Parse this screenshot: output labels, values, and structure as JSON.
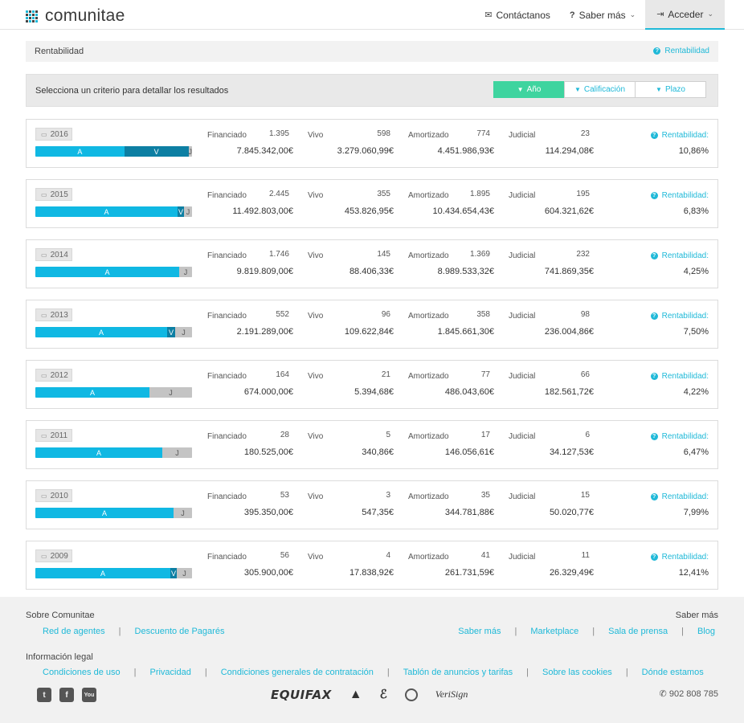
{
  "header": {
    "logo": "comunitae",
    "nav": [
      {
        "label": "Contáctanos",
        "icon": "envelope-icon"
      },
      {
        "label": "Saber más",
        "icon": "question-icon"
      },
      {
        "label": "Acceder",
        "icon": "sign-in-icon"
      }
    ]
  },
  "breadcrumb": {
    "title": "Rentabilidad",
    "help_link": "Rentabilidad"
  },
  "criteria": {
    "label": "Selecciona un criterio para detallar los resultados",
    "options": [
      "Año",
      "Calificación",
      "Plazo"
    ],
    "selected": "Año"
  },
  "labels": {
    "financiado": "Financiado",
    "vivo": "Vivo",
    "amortizado": "Amortizado",
    "judicial": "Judicial",
    "rentabilidad": "Rentabilidad:"
  },
  "years": [
    {
      "year": "2016",
      "fin_count": "1.395",
      "fin_amount": "7.845.342,00€",
      "vivo_count": "598",
      "vivo_amount": "3.279.060,99€",
      "amort_count": "774",
      "amort_amount": "4.451.986,93€",
      "jud_count": "23",
      "jud_amount": "114.294,08€",
      "rent": "10,86%",
      "bar": {
        "a": 0.57,
        "v": 0.41,
        "a_label": "A",
        "v_label": "V",
        "j_label": "J"
      }
    },
    {
      "year": "2015",
      "fin_count": "2.445",
      "fin_amount": "11.492.803,00€",
      "vivo_count": "355",
      "vivo_amount": "453.826,95€",
      "amort_count": "1.895",
      "amort_amount": "10.434.654,43€",
      "jud_count": "195",
      "jud_amount": "604.321,62€",
      "rent": "6,83%",
      "bar": {
        "a": 0.91,
        "v": 0.04,
        "a_label": "A",
        "v_label": "V",
        "j_label": "J"
      }
    },
    {
      "year": "2014",
      "fin_count": "1.746",
      "fin_amount": "9.819.809,00€",
      "vivo_count": "145",
      "vivo_amount": "88.406,33€",
      "amort_count": "1.369",
      "amort_amount": "8.989.533,32€",
      "jud_count": "232",
      "jud_amount": "741.869,35€",
      "rent": "4,25%",
      "bar": {
        "a": 0.92,
        "v": 0.0,
        "a_label": "A",
        "v_label": "",
        "j_label": "J"
      }
    },
    {
      "year": "2013",
      "fin_count": "552",
      "fin_amount": "2.191.289,00€",
      "vivo_count": "96",
      "vivo_amount": "109.622,84€",
      "amort_count": "358",
      "amort_amount": "1.845.661,30€",
      "jud_count": "98",
      "jud_amount": "236.004,86€",
      "rent": "7,50%",
      "bar": {
        "a": 0.84,
        "v": 0.05,
        "a_label": "A",
        "v_label": "V",
        "j_label": "J"
      }
    },
    {
      "year": "2012",
      "fin_count": "164",
      "fin_amount": "674.000,00€",
      "vivo_count": "21",
      "vivo_amount": "5.394,68€",
      "amort_count": "77",
      "amort_amount": "486.043,60€",
      "jud_count": "66",
      "jud_amount": "182.561,72€",
      "rent": "4,22%",
      "bar": {
        "a": 0.73,
        "v": 0.0,
        "a_label": "A",
        "v_label": "",
        "j_label": "J"
      }
    },
    {
      "year": "2011",
      "fin_count": "28",
      "fin_amount": "180.525,00€",
      "vivo_count": "5",
      "vivo_amount": "340,86€",
      "amort_count": "17",
      "amort_amount": "146.056,61€",
      "jud_count": "6",
      "jud_amount": "34.127,53€",
      "rent": "6,47%",
      "bar": {
        "a": 0.81,
        "v": 0.0,
        "a_label": "A",
        "v_label": "",
        "j_label": "J"
      }
    },
    {
      "year": "2010",
      "fin_count": "53",
      "fin_amount": "395.350,00€",
      "vivo_count": "3",
      "vivo_amount": "547,35€",
      "amort_count": "35",
      "amort_amount": "344.781,88€",
      "jud_count": "15",
      "jud_amount": "50.020,77€",
      "rent": "7,99%",
      "bar": {
        "a": 0.88,
        "v": 0.0,
        "a_label": "A",
        "v_label": "",
        "j_label": "J"
      }
    },
    {
      "year": "2009",
      "fin_count": "56",
      "fin_amount": "305.900,00€",
      "vivo_count": "4",
      "vivo_amount": "17.838,92€",
      "amort_count": "41",
      "amort_amount": "261.731,59€",
      "jud_count": "11",
      "jud_amount": "26.329,49€",
      "rent": "12,41%",
      "bar": {
        "a": 0.86,
        "v": 0.04,
        "a_label": "A",
        "v_label": "V",
        "j_label": "J"
      }
    }
  ],
  "footer": {
    "about_heading": "Sobre Comunitae",
    "about_links": [
      "Red de agentes",
      "Descuento de Pagarés"
    ],
    "saber_heading": "Saber más",
    "saber_links": [
      "Saber más",
      "Marketplace",
      "Sala de prensa",
      "Blog"
    ],
    "legal_heading": "Información legal",
    "legal_links": [
      "Condiciones de uso",
      "Privacidad",
      "Condiciones generales de contratación",
      "Tablón de anuncios y tarifas",
      "Sobre las cookies",
      "Dónde estamos"
    ],
    "social": [
      "twitter-icon",
      "facebook-icon",
      "youtube-icon"
    ],
    "partners": {
      "equifax": "EQUIFAX",
      "veri": "VeriSign"
    },
    "phone": "902 808 785"
  },
  "colors": {
    "accent": "#1fb9d8",
    "active_segment": "#3ed49f",
    "bar_a": "#10b8e3",
    "bar_v": "#0d7fa3",
    "bar_j": "#c4c4c4"
  }
}
